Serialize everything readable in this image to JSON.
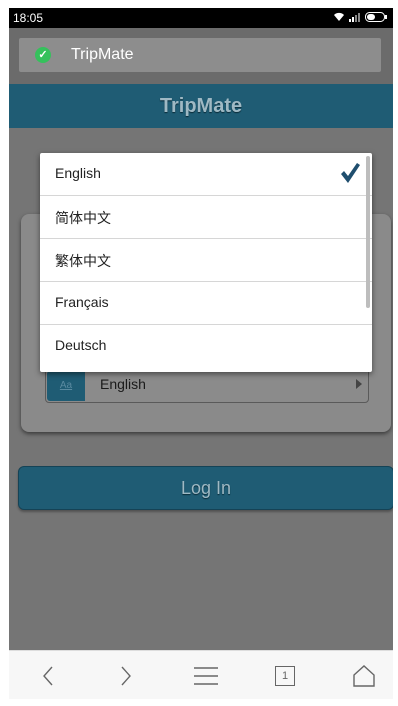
{
  "status_bar": {
    "time": "18:05",
    "icons": [
      "wifi-icon",
      "signal-icon",
      "battery-icon"
    ]
  },
  "browser": {
    "title": "TripMate",
    "secure_icon": "check-circle-icon"
  },
  "app": {
    "header_title": "TripMate"
  },
  "language_select": {
    "icon_text": "Aa",
    "value": "English"
  },
  "login_button": {
    "label": "Log In"
  },
  "dropdown": {
    "options": [
      {
        "label": "English",
        "selected": true
      },
      {
        "label": "简体中文",
        "selected": false
      },
      {
        "label": "繁体中文",
        "selected": false
      },
      {
        "label": "Français",
        "selected": false
      },
      {
        "label": "Deutsch",
        "selected": false
      }
    ]
  },
  "bottom_nav": {
    "items": [
      "back-icon",
      "forward-icon",
      "menu-icon",
      "tabs-icon",
      "home-icon"
    ],
    "tab_count": "1"
  },
  "colors": {
    "header": "#1f5c74",
    "check": "#1f4e6e",
    "secure": "#35c15c"
  }
}
